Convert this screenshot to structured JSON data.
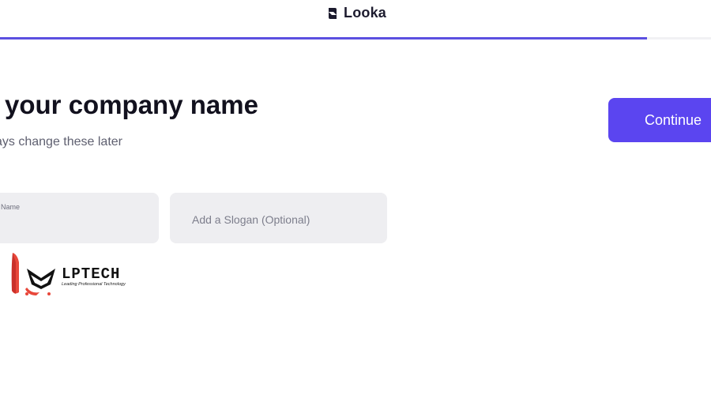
{
  "header": {
    "brand_name": "Looka",
    "progress_fraction": 0.91,
    "accent": "#5b4fe0"
  },
  "main": {
    "title": "r your company name",
    "subtitle": "always change these later",
    "continue_label": "Continue",
    "continue_color": "#5b45f0"
  },
  "form": {
    "name_label": "Name",
    "slogan_placeholder": "Add a Slogan (Optional)"
  },
  "watermark": {
    "name": "LPTECH",
    "tagline": "Leading Professional Technology",
    "icon": "fox-mascot-icon"
  }
}
